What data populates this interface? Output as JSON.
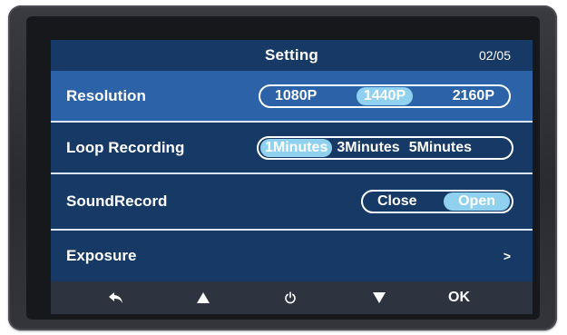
{
  "screen": {
    "title": "Setting",
    "page_indicator": "02/05"
  },
  "rows": [
    {
      "label": "Resolution",
      "options": [
        "1080P",
        "1440P",
        "2160P"
      ],
      "selected_option": "1440P",
      "row_selected": true
    },
    {
      "label": "Loop Recording",
      "options": [
        "1Minutes",
        "3Minutes",
        "5Minutes"
      ],
      "selected_option": "1Minutes",
      "row_selected": false
    },
    {
      "label": "SoundRecord",
      "options": [
        "Close",
        "Open"
      ],
      "selected_option": "Open",
      "row_selected": false
    },
    {
      "label": "Exposure",
      "arrow": ">",
      "row_selected": false
    }
  ],
  "toolbar": {
    "back_icon": "back-arrow-icon",
    "up_icon": "triangle-up-icon",
    "power_icon": "power-icon",
    "down_icon": "triangle-down-icon",
    "ok_label": "OK"
  },
  "colors": {
    "screen_bg": "#173966",
    "selected_row_bg": "#2b62a8",
    "active_option_bg": "#8fd1ee",
    "toolbar_bg": "#2e3340",
    "bezel": "#2a2b30"
  }
}
